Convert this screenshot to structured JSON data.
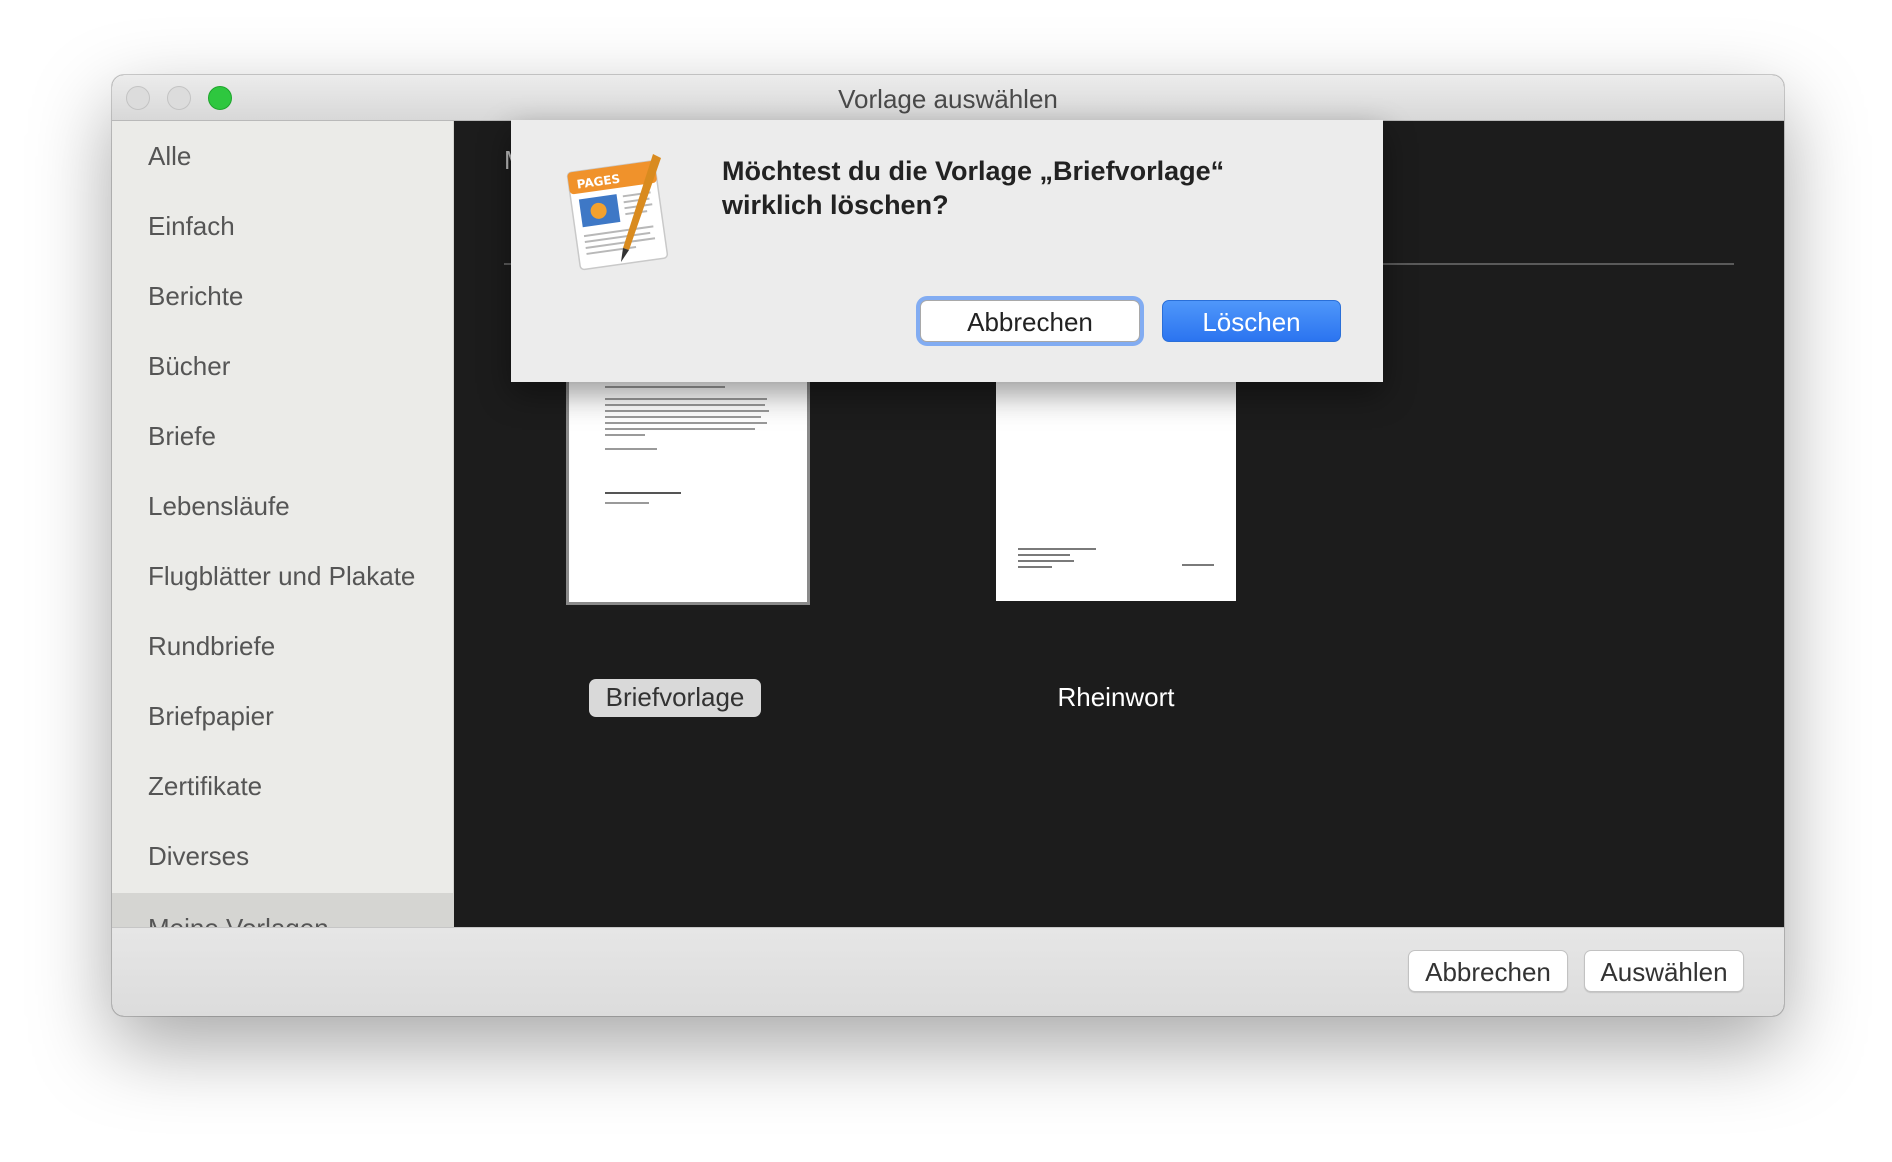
{
  "window": {
    "title": "Vorlage auswählen"
  },
  "sidebar": {
    "items": [
      {
        "label": "Alle"
      },
      {
        "label": "Einfach"
      },
      {
        "label": "Berichte"
      },
      {
        "label": "Bücher"
      },
      {
        "label": "Briefe"
      },
      {
        "label": "Lebensläufe"
      },
      {
        "label": "Flugblätter und Plakate"
      },
      {
        "label": "Rundbriefe"
      },
      {
        "label": "Briefpapier"
      },
      {
        "label": "Zertifikate"
      },
      {
        "label": "Diverses"
      },
      {
        "label": "Meine Vorlagen",
        "selected": true
      }
    ]
  },
  "main": {
    "section_title_partial": "M",
    "templates": [
      {
        "name": "Briefvorlage",
        "selected": true,
        "signature": "Markus Mustermann",
        "closing": "Mit freundlichen Grüßen"
      },
      {
        "name": "Rheinwort",
        "selected": false,
        "footer_right": "Seite 1 von 1"
      }
    ]
  },
  "footer": {
    "cancel_label": "Abbrechen",
    "choose_label": "Auswählen"
  },
  "alert": {
    "app_icon": "pages-app-icon",
    "app_icon_label": "PAGES",
    "message": "Möchtest du die Vorlage „Briefvorlage“ wirklich löschen?",
    "cancel_label": "Abbrechen",
    "delete_label": "Löschen"
  },
  "colors": {
    "accent": "#2f78f2",
    "focus_ring": "#82acf2",
    "zoom_button": "#2ec73f",
    "main_background": "#1c1c1c",
    "sidebar_background": "#ebebe8",
    "pages_orange": "#f0922b"
  }
}
